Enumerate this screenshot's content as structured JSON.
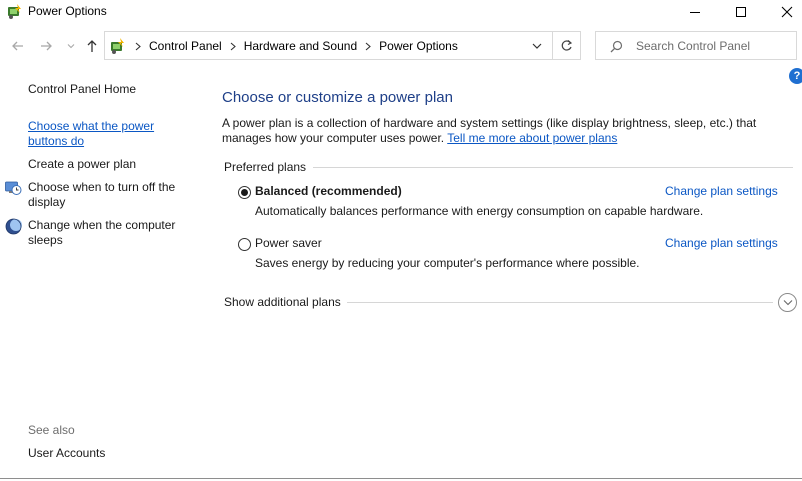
{
  "window": {
    "title": "Power Options",
    "icon": "power-options-icon"
  },
  "navigation": {
    "breadcrumbs": [
      "Control Panel",
      "Hardware and Sound",
      "Power Options"
    ],
    "search_placeholder": "Search Control Panel"
  },
  "sidebar": {
    "home": "Control Panel Home",
    "links": [
      "Choose what the power buttons do",
      "Create a power plan",
      "Choose when to turn off the display",
      "Change when the computer sleeps"
    ],
    "see_also_label": "See also",
    "see_also_links": [
      "User Accounts"
    ]
  },
  "main": {
    "title": "Choose or customize a power plan",
    "intro_text": "A power plan is a collection of hardware and system settings (like display brightness, sleep, etc.) that manages how your computer uses power. ",
    "intro_link": "Tell me more about power plans",
    "preferred_label": "Preferred plans",
    "plans": [
      {
        "name": "Balanced (recommended)",
        "description": "Automatically balances performance with energy consumption on capable hardware.",
        "selected": true,
        "change_label": "Change plan settings"
      },
      {
        "name": "Power saver",
        "description": "Saves energy by reducing your computer's performance where possible.",
        "selected": false,
        "change_label": "Change plan settings"
      }
    ],
    "additional_label": "Show additional plans"
  },
  "help_label": "?",
  "colors": {
    "link": "#0b57c4",
    "title": "#1e3f88",
    "help": "#1f6fd1"
  }
}
